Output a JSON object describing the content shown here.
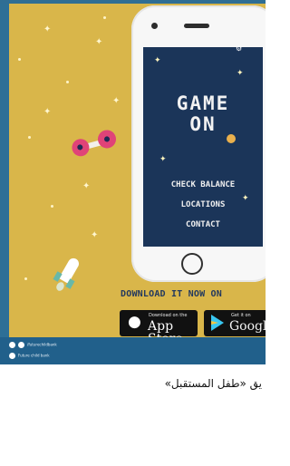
{
  "poster": {
    "phone_screen": {
      "title_line1": "GAME",
      "title_line2": "ON",
      "menu_items": [
        "CHECK BALANCE",
        "LOCATIONS",
        "CONTACT"
      ]
    },
    "download_text": "DOWNLOAD IT NOW ON",
    "app_store": {
      "small_label": "Download on the",
      "large_label": "App Store",
      "icon": "apple-icon"
    },
    "google_play": {
      "small_label": "Get it on",
      "large_label": "Googl",
      "icon": "play-store-icon"
    }
  },
  "social_strip": {
    "line1": "/futurechildbank",
    "line2": "Future child bank"
  },
  "caption": "يق «طفل المستقبل»",
  "colors": {
    "poster_bg": "#d9b64a",
    "frame_blue": "#2d6f96",
    "screen_bg": "#1b3559",
    "download_text": "#23395f"
  }
}
